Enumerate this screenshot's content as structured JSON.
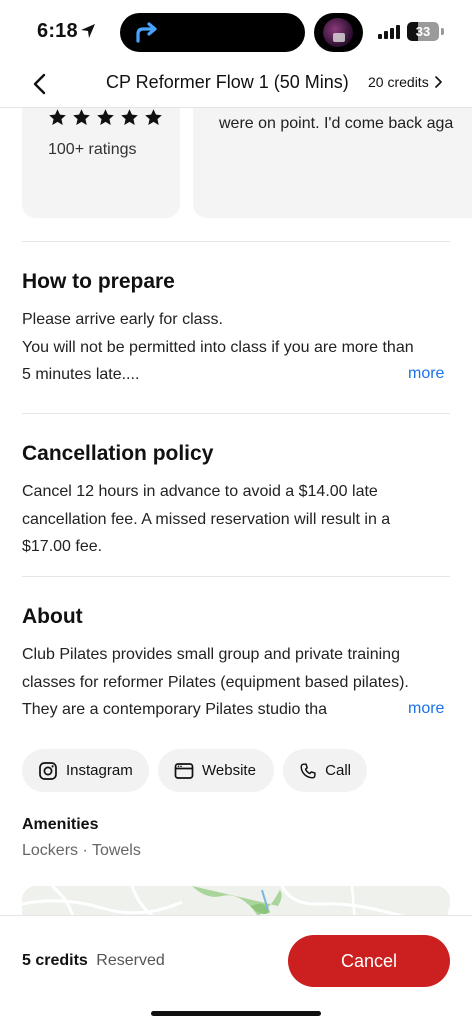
{
  "status_bar": {
    "time": "6:18",
    "battery_level": "33"
  },
  "header": {
    "title": "CP Reformer Flow 1 (50 Mins)",
    "credits": "20 credits"
  },
  "rating": {
    "count_label": "100+ ratings",
    "stars": 5
  },
  "review": {
    "text": "were on point. I'd come back aga"
  },
  "prepare": {
    "title": "How to prepare",
    "line1": "Please arrive early for class.",
    "line2": "You will not be permitted into class if you are more than",
    "line3": "5 minutes late....",
    "more": "more"
  },
  "cancellation": {
    "title": "Cancellation policy",
    "text": "Cancel 12 hours in advance to avoid a $14.00 late cancellation fee. A missed reservation will result in a $17.00 fee."
  },
  "about": {
    "title": "About",
    "line1": "Club Pilates provides small group and private training",
    "line2": "classes for reformer Pilates (equipment based pilates).",
    "line3": "They are a contemporary Pilates studio tha",
    "more": "more"
  },
  "links": {
    "instagram": "Instagram",
    "website": "Website",
    "call": "Call"
  },
  "amenities": {
    "title": "Amenities",
    "list": "Lockers · Towels"
  },
  "bottom": {
    "credits": "5 credits",
    "status": "Reserved",
    "cancel_label": "Cancel"
  },
  "colors": {
    "accent_red": "#cc1f1f",
    "link_blue": "#1a73e8"
  }
}
